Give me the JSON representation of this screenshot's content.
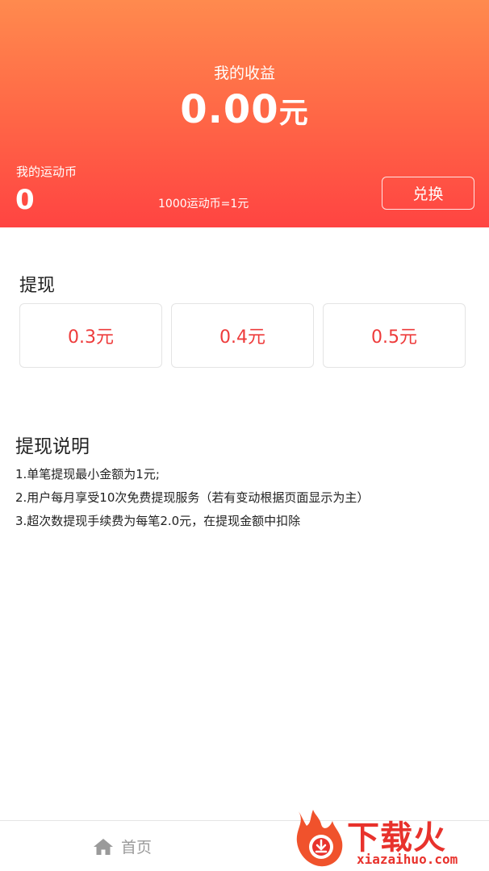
{
  "header": {
    "earnings_label": "我的收益",
    "earnings_amount": "0.00",
    "earnings_unit": "元",
    "coins_label": "我的运动币",
    "coins_value": "0",
    "exchange_rate": "1000运动币=1元",
    "exchange_button": "兑换"
  },
  "withdraw": {
    "title": "提现",
    "options": [
      "0.3元",
      "0.4元",
      "0.5元"
    ]
  },
  "description": {
    "title": "提现说明",
    "items": [
      "1.单笔提现最小金额为1元;",
      "2.用户每月享受10次免费提现服务（若有变动根据页面显示为主）",
      "3.超次数提现手续费为每笔2.0元，在提现金额中扣除"
    ]
  },
  "bottom_nav": {
    "home_label": "首页",
    "home_icon": "home-icon"
  },
  "watermark": {
    "logo_text": "下载火",
    "url": "xiazaihuo.com"
  },
  "colors": {
    "header_top": "#ff8a4e",
    "header_bottom": "#ff4442",
    "accent_red": "#ee3b3b"
  }
}
